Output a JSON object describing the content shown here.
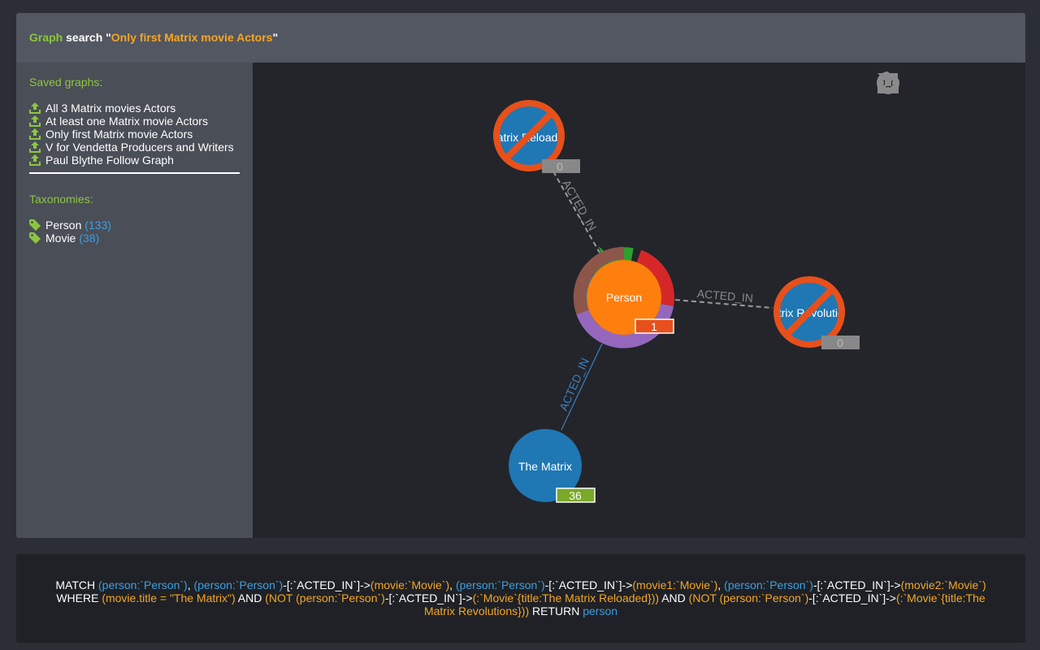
{
  "header": {
    "graph_label": "Graph",
    "search_label": " search \"",
    "query_name": "Only first Matrix movie Actors",
    "close_quote": "\""
  },
  "sidebar": {
    "saved_title": "Saved graphs:",
    "saved_graphs": [
      "All 3 Matrix movies Actors",
      "At least one Matrix movie Actors",
      "Only first Matrix movie Actors",
      "V for Vendetta Producers and Writers",
      "Paul Blythe Follow Graph"
    ],
    "taxonomies_title": "Taxonomies:",
    "taxonomies": [
      {
        "name": "Person",
        "count": "(133)"
      },
      {
        "name": "Movie",
        "count": "(38)"
      }
    ]
  },
  "toolbar": {
    "icons": [
      "pie-toggle-icon",
      "refresh-icon",
      "center-icon",
      "fullscreen-icon",
      "export-icon"
    ]
  },
  "graph": {
    "nodes": {
      "person": {
        "label": "Person",
        "badge": "1"
      },
      "reloaded": {
        "label": "Matrix Reloaded",
        "badge": "0"
      },
      "revolutions": {
        "label": "Matrix Revolutions",
        "badge": "0"
      },
      "matrix": {
        "label": "The Matrix",
        "badge": "36"
      }
    },
    "edges": {
      "to_reloaded": "ACTED_IN",
      "to_revolutions": "ACTED_IN",
      "to_matrix": "ACTED_IN"
    }
  },
  "query": {
    "p1": "MATCH ",
    "p2": "(person:`Person`)",
    "p3": ", ",
    "p4": "(person:`Person`)",
    "p5": "-[:`ACTED_IN`]->",
    "p6": "(movie:`Movie`)",
    "p7": ", ",
    "p8": "(person:`Person`)",
    "p9": "-[:`ACTED_IN`]->",
    "p10": "(movie1:`Movie`)",
    "p11": ", ",
    "p12": "(person:`Person`)",
    "p13": "-[:`ACTED_IN`]->",
    "p14": "(movie2:`Movie`)",
    "p15": " WHERE ",
    "p16": "(movie.title = \"The Matrix\")",
    "p17": " AND ",
    "p18": "(NOT (person:`Person`)",
    "p19": "-[:`ACTED_IN`]->",
    "p20": "(:`Movie`{title:The Matrix Reloaded}))",
    "p21": " AND ",
    "p22": "(NOT (person:`Person`)",
    "p23": "-[:`ACTED_IN`]->",
    "p24": "(:`Movie`{title:The Matrix Revolutions}))",
    "p25": " RETURN ",
    "p26": "person"
  },
  "colors": {
    "accent_green": "#8cc63f",
    "accent_orange": "#f5a623",
    "link_blue": "#3d9fe0",
    "node_orange": "#ff7f0e",
    "node_blue": "#1f77b4",
    "forbid_red": "#e8501b"
  }
}
